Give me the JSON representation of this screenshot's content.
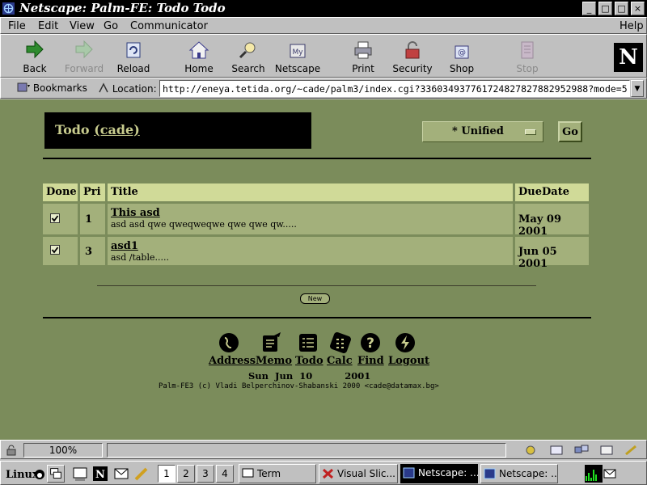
{
  "window": {
    "title": "Netscape: Palm-FE: Todo Todo",
    "controls": [
      "_",
      "□",
      "□",
      "×"
    ]
  },
  "menu": [
    "File",
    "Edit",
    "View",
    "Go",
    "Communicator",
    "Help"
  ],
  "toolbar": {
    "buttons": [
      {
        "label": "Back",
        "icon": "back-arrow-icon",
        "enabled": true
      },
      {
        "label": "Forward",
        "icon": "forward-arrow-icon",
        "enabled": false
      },
      {
        "label": "Reload",
        "icon": "reload-icon",
        "enabled": true
      },
      {
        "label": "Home",
        "icon": "home-icon",
        "enabled": true
      },
      {
        "label": "Search",
        "icon": "search-icon",
        "enabled": true
      },
      {
        "label": "Netscape",
        "icon": "my-netscape-icon",
        "enabled": true
      },
      {
        "label": "Print",
        "icon": "print-icon",
        "enabled": true
      },
      {
        "label": "Security",
        "icon": "security-lock-icon",
        "enabled": true
      },
      {
        "label": "Shop",
        "icon": "shop-bag-icon",
        "enabled": true
      },
      {
        "label": "Stop",
        "icon": "stop-icon",
        "enabled": false
      }
    ],
    "logo": "N"
  },
  "location_bar": {
    "bookmarks_label": "Bookmarks",
    "location_label": "Location:",
    "url": "http://eneya.tetida.org/~cade/palm3/index.cgi?336034937761724827827882952988?mode=5"
  },
  "page": {
    "header": {
      "title": "Todo",
      "user": "(cade)"
    },
    "view_select": {
      "selected": "* Unified"
    },
    "go_label": "Go",
    "table": {
      "columns": [
        "Done",
        "Pri",
        "Title",
        "DueDate"
      ],
      "rows": [
        {
          "done": true,
          "pri": "1",
          "title": "This asd",
          "description": "asd asd qwe qweqweqwe qwe qwe qw.....",
          "due": "May 09 2001"
        },
        {
          "done": true,
          "pri": "3",
          "title": "asd1",
          "description": "asd /table.....",
          "due": "Jun 05 2001"
        }
      ]
    },
    "new_label": "New",
    "nav": [
      {
        "label": "Address",
        "icon": "address-icon"
      },
      {
        "label": "Memo",
        "icon": "memo-icon"
      },
      {
        "label": "Todo",
        "icon": "todo-icon"
      },
      {
        "label": "Calc",
        "icon": "calc-icon"
      },
      {
        "label": "Find",
        "icon": "find-icon"
      },
      {
        "label": "Logout",
        "icon": "logout-icon"
      }
    ],
    "date_line": "Sun  Jun  10          2001",
    "copyright": "Palm-FE3 (c) Vladi Belperchinov-Shabanski 2000 <cade@datamax.bg>",
    "colors": {
      "page_bg": "#7b8c5b",
      "header_row": "#d0da98",
      "cell": "#a3b07b",
      "header_text": "#c8cc8e"
    }
  },
  "status": {
    "zoom": "100%",
    "message": ""
  },
  "taskbar": {
    "desktops": [
      "1",
      "2",
      "3",
      "4"
    ],
    "active_desktop": "1",
    "tasks": [
      {
        "label": "Term",
        "active": false
      },
      {
        "label": "Visual Slic...",
        "active": false
      },
      {
        "label": "Netscape: ...",
        "active": true
      },
      {
        "label": "Netscape: ...",
        "active": false
      }
    ]
  }
}
